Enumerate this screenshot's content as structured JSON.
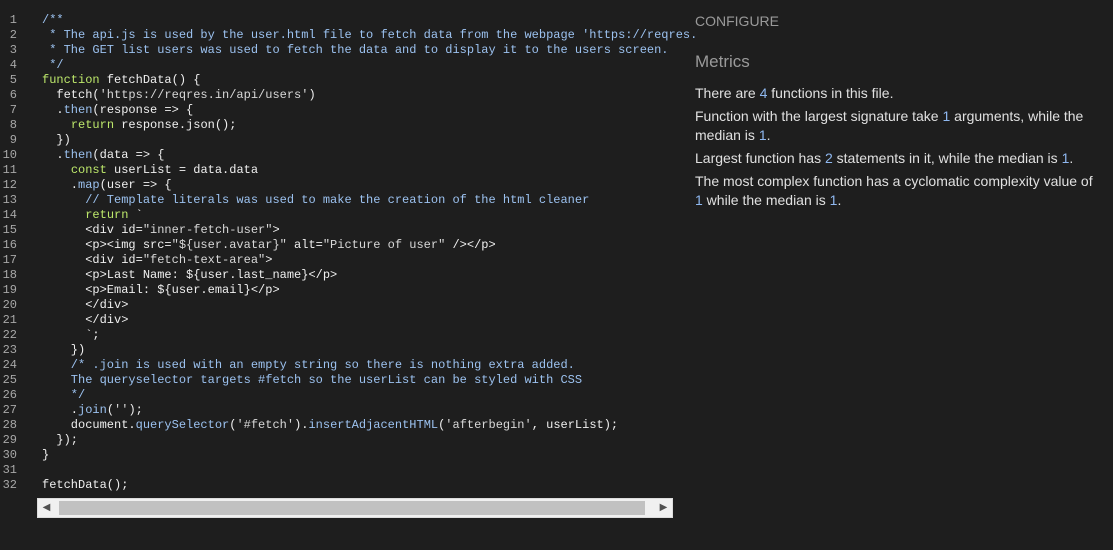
{
  "code_lines": [
    [
      [
        "cm",
        "/**"
      ]
    ],
    [
      [
        "cm",
        " * The api.js is used by the user.html file to fetch data from the webpage 'https://reqres."
      ]
    ],
    [
      [
        "cm",
        " * The GET list users was used to fetch the data and to display it to the users screen."
      ]
    ],
    [
      [
        "cm",
        " */"
      ]
    ],
    [
      [
        "kw",
        "function"
      ],
      [
        "plain",
        " fetchData() {"
      ]
    ],
    [
      [
        "plain",
        "  fetch("
      ],
      [
        "str",
        "'https://reqres.in/api/users'"
      ],
      [
        "plain",
        ")"
      ]
    ],
    [
      [
        "plain",
        "  ."
      ],
      [
        "fn",
        "then"
      ],
      [
        "plain",
        "(response => {"
      ]
    ],
    [
      [
        "plain",
        "    "
      ],
      [
        "kw",
        "return"
      ],
      [
        "plain",
        " response.json();"
      ]
    ],
    [
      [
        "plain",
        "  })"
      ]
    ],
    [
      [
        "plain",
        "  ."
      ],
      [
        "fn",
        "then"
      ],
      [
        "plain",
        "(data => {"
      ]
    ],
    [
      [
        "plain",
        "    "
      ],
      [
        "kw",
        "const"
      ],
      [
        "plain",
        " userList = data.data"
      ]
    ],
    [
      [
        "plain",
        "    ."
      ],
      [
        "fn",
        "map"
      ],
      [
        "plain",
        "(user => {"
      ]
    ],
    [
      [
        "cm",
        "      // Template literals was used to make the creation of the html cleaner"
      ]
    ],
    [
      [
        "plain",
        "      "
      ],
      [
        "kw",
        "return"
      ],
      [
        "plain",
        " `"
      ]
    ],
    [
      [
        "plain",
        "      <div id="
      ],
      [
        "str",
        "\"inner-fetch-user\""
      ],
      [
        "plain",
        ">"
      ]
    ],
    [
      [
        "plain",
        "      <p><img src="
      ],
      [
        "str",
        "\"${user.avatar}\""
      ],
      [
        "plain",
        " alt="
      ],
      [
        "str",
        "\"Picture of user\""
      ],
      [
        "plain",
        " /></p>"
      ]
    ],
    [
      [
        "plain",
        "      <div id="
      ],
      [
        "str",
        "\"fetch-text-area\""
      ],
      [
        "plain",
        ">"
      ]
    ],
    [
      [
        "plain",
        "      <p>Last Name: ${user.last_name}</p>"
      ]
    ],
    [
      [
        "plain",
        "      <p>Email: ${user.email}</p>"
      ]
    ],
    [
      [
        "plain",
        "      </div>"
      ]
    ],
    [
      [
        "plain",
        "      </div>"
      ]
    ],
    [
      [
        "plain",
        "      `;"
      ]
    ],
    [
      [
        "plain",
        "    })"
      ]
    ],
    [
      [
        "cm",
        "    /* .join is used with an empty string so there is nothing extra added."
      ]
    ],
    [
      [
        "cm",
        "    The queryselector targets #fetch so the userList can be styled with CSS"
      ]
    ],
    [
      [
        "cm",
        "    */"
      ]
    ],
    [
      [
        "plain",
        "    ."
      ],
      [
        "fn",
        "join"
      ],
      [
        "plain",
        "("
      ],
      [
        "str",
        "''"
      ],
      [
        "plain",
        ");"
      ]
    ],
    [
      [
        "plain",
        "    document."
      ],
      [
        "fn",
        "querySelector"
      ],
      [
        "plain",
        "("
      ],
      [
        "str",
        "'#fetch'"
      ],
      [
        "plain",
        ")."
      ],
      [
        "fn",
        "insertAdjacentHTML"
      ],
      [
        "plain",
        "("
      ],
      [
        "str",
        "'afterbegin'"
      ],
      [
        "plain",
        ", userList);"
      ]
    ],
    [
      [
        "plain",
        "  });"
      ]
    ],
    [
      [
        "plain",
        "}"
      ]
    ],
    [
      [
        "plain",
        ""
      ]
    ],
    [
      [
        "plain",
        "fetchData();"
      ]
    ]
  ],
  "line_numbers": [
    "1",
    "2",
    "3",
    "4",
    "5",
    "6",
    "7",
    "8",
    "9",
    "10",
    "11",
    "12",
    "13",
    "14",
    "15",
    "16",
    "17",
    "18",
    "19",
    "20",
    "21",
    "22",
    "23",
    "24",
    "25",
    "26",
    "27",
    "28",
    "29",
    "30",
    "31",
    "32"
  ],
  "panel": {
    "configure_label": "CONFIGURE",
    "metrics_title": "Metrics",
    "functions_count_prefix": "There are ",
    "functions_count": "4",
    "functions_count_suffix": " functions in this file.",
    "signature_prefix": "Function with the largest signature take ",
    "signature_max": "1",
    "signature_mid": " arguments, while the median is ",
    "signature_median": "1",
    "signature_suffix": ".",
    "statements_prefix": "Largest function has ",
    "statements_max": "2",
    "statements_mid": " statements in it, while the median is ",
    "statements_median": "1",
    "statements_suffix": ".",
    "complexity_prefix": "The most complex function has a cyclomatic complexity value of ",
    "complexity_max": "1",
    "complexity_mid": " while the median is ",
    "complexity_median": "1",
    "complexity_suffix": "."
  },
  "scrollbar": {
    "left_arrow_icon": "triangle-left-icon",
    "right_arrow_icon": "triangle-right-icon"
  },
  "colors": {
    "background": "#1e1e1e",
    "keyword": "#bde86b",
    "comment": "#9cc2f0",
    "metric_number": "#8fb8f0"
  }
}
